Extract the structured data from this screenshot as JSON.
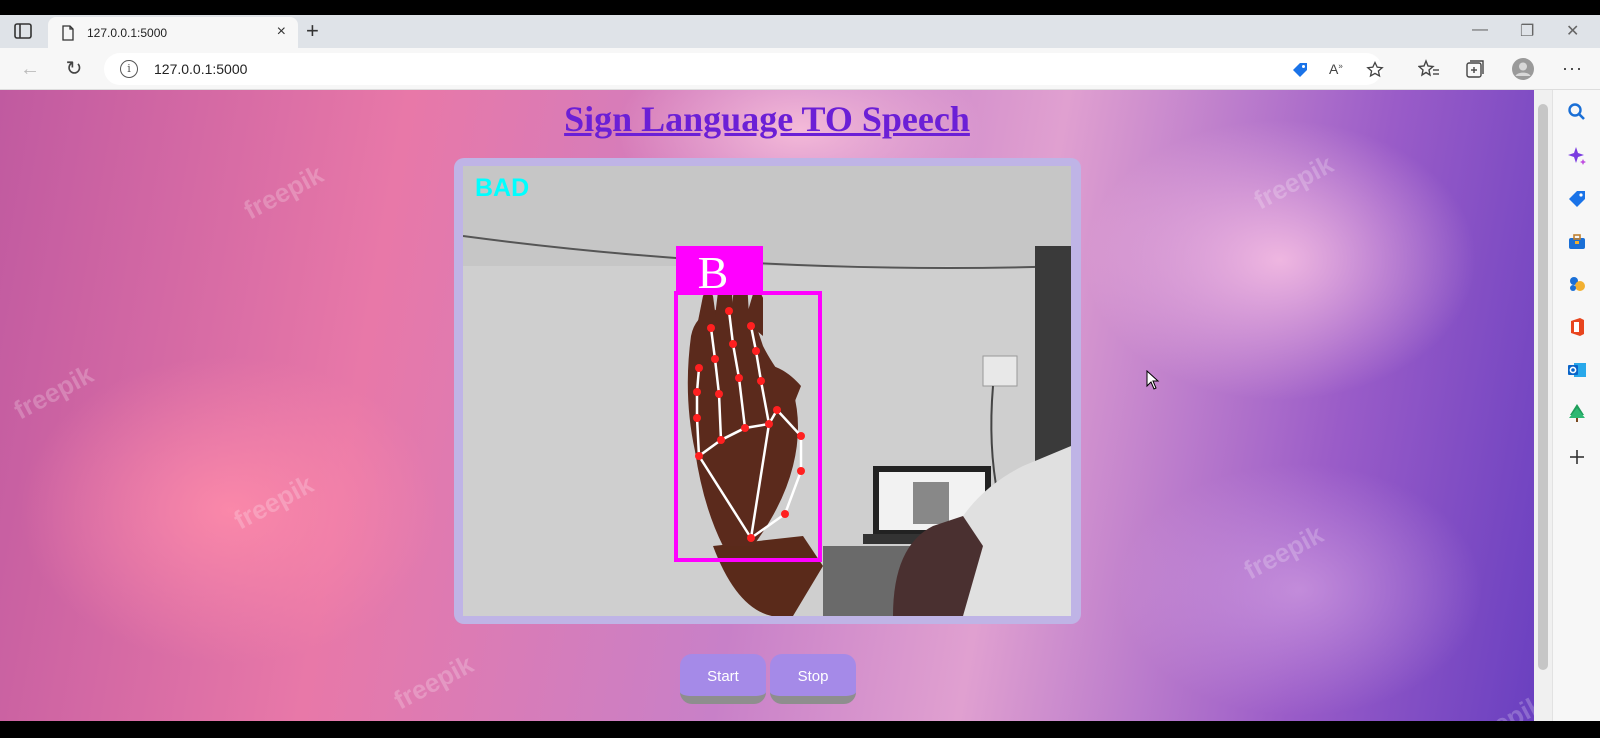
{
  "browser": {
    "tab_title": "127.0.0.1:5000",
    "url": "127.0.0.1:5000",
    "tab_close": "×",
    "new_tab": "+"
  },
  "page": {
    "heading": "Sign Language TO Speech",
    "video": {
      "status_label": "BAD",
      "prediction_letter": "B",
      "watermark": "freepik"
    },
    "buttons": {
      "start": "Start",
      "stop": "Stop"
    }
  },
  "colors": {
    "heading": "#6b1fd6",
    "button": "#a58ae8",
    "detection_box": "#ff00ff",
    "status_label": "#00ffff",
    "landmark": "#ff2020"
  },
  "sidebar_icons": [
    "search-icon",
    "copilot-icon",
    "shopping-icon",
    "tools-icon",
    "games-icon",
    "office-icon",
    "outlook-icon",
    "tree-icon",
    "add-icon"
  ]
}
